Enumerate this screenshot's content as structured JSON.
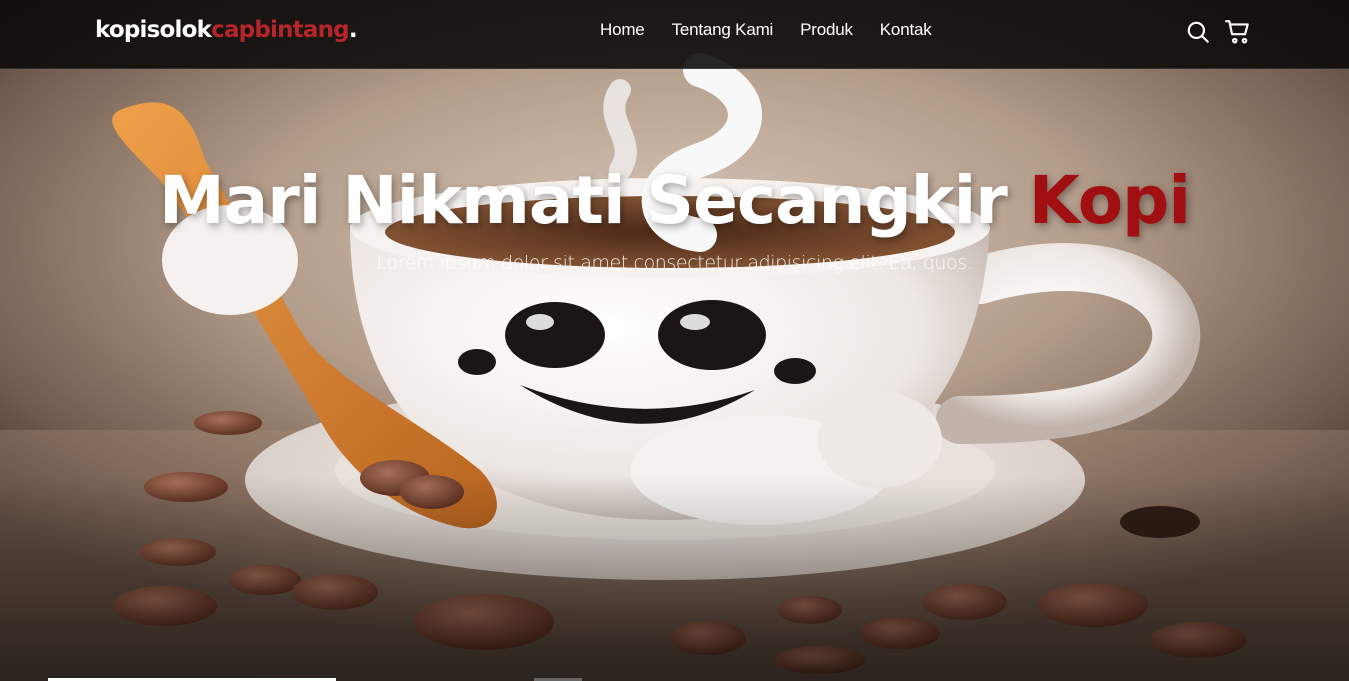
{
  "brand": {
    "logo_main": "kopisolok",
    "logo_accent": "capbintang",
    "logo_dot": ".",
    "accent_color": "#b6252a"
  },
  "nav": {
    "items": [
      {
        "label": "Home"
      },
      {
        "label": "Tentang Kami"
      },
      {
        "label": "Produk"
      },
      {
        "label": "Kontak"
      }
    ],
    "icons": [
      "search-icon",
      "shopping-cart-icon"
    ]
  },
  "hero": {
    "title_main": "Mari Nikmati Secangkir ",
    "title_accent": "Kopi",
    "subtitle": "Lorem ipsum dolor sit amet consectetur adipisicing elit. Ea, quos.",
    "title_accent_color": "#a10f12",
    "image": "coffee-cup-mascot-illustration"
  }
}
